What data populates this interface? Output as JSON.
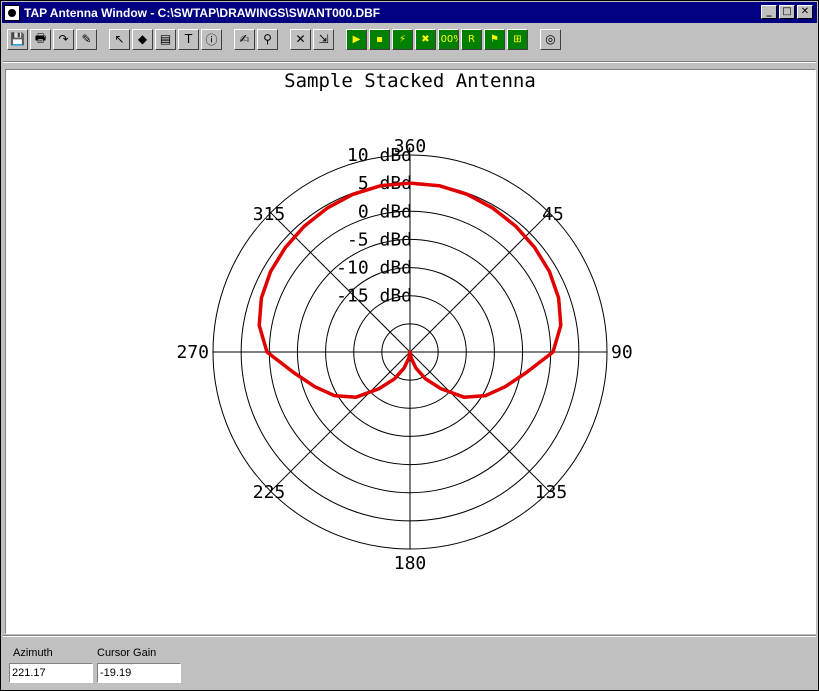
{
  "window": {
    "title": "TAP Antenna Window - C:\\SWTAP\\DRAWINGS\\SWANT000.DBF",
    "min_glyph": "_",
    "max_glyph": "□",
    "close_glyph": "✕"
  },
  "toolbar": {
    "buttons": [
      {
        "name": "save-icon",
        "glyph": "💾"
      },
      {
        "name": "print-icon",
        "glyph": "🖶"
      },
      {
        "name": "redo-icon",
        "glyph": "↷"
      },
      {
        "name": "edit-icon",
        "glyph": "✎"
      },
      {
        "name": "pointer-icon",
        "glyph": "↖"
      },
      {
        "name": "fill-icon",
        "glyph": "◆"
      },
      {
        "name": "document-icon",
        "glyph": "▤"
      },
      {
        "name": "text-icon",
        "glyph": "T"
      },
      {
        "name": "info-icon",
        "glyph": "ⓘ"
      },
      {
        "name": "sign-icon",
        "glyph": "✍"
      },
      {
        "name": "search-icon",
        "glyph": "⚲"
      },
      {
        "name": "delete-icon",
        "glyph": "✕"
      },
      {
        "name": "import-icon",
        "glyph": "⇲"
      },
      {
        "name": "play-icon",
        "glyph": "▶"
      },
      {
        "name": "dot-icon",
        "glyph": "▪"
      },
      {
        "name": "wand-icon",
        "glyph": "⚡"
      },
      {
        "name": "mark-icon",
        "glyph": "✖"
      },
      {
        "name": "zoom-100-icon",
        "glyph": "100%"
      },
      {
        "name": "r-icon",
        "glyph": "R"
      },
      {
        "name": "flag-icon",
        "glyph": "⚑"
      },
      {
        "name": "grid-icon",
        "glyph": "⊞"
      },
      {
        "name": "target-icon",
        "glyph": "◎"
      }
    ]
  },
  "chart_data": {
    "type": "polar",
    "title": "Sample Stacked Antenna",
    "radial_labels": [
      "10 dBd",
      "5 dBd",
      "0 dBd",
      "-5 dBd",
      "-10 dBd",
      "-15 dBd"
    ],
    "radial_levels": [
      10,
      5,
      0,
      -5,
      -10,
      -15,
      -20
    ],
    "angle_labels": [
      "360",
      "45",
      "90",
      "135",
      "180",
      "225",
      "270",
      "315"
    ],
    "angles_deg": [
      0,
      45,
      90,
      135,
      180,
      225,
      270,
      315
    ],
    "series_color": "#e00000",
    "pattern": {
      "azimuth_deg": [
        0,
        10,
        20,
        30,
        40,
        50,
        60,
        70,
        80,
        90,
        100,
        110,
        120,
        130,
        140,
        150,
        160,
        170,
        180,
        190,
        200,
        210,
        220,
        230,
        240,
        250,
        260,
        270,
        280,
        290,
        300,
        310,
        320,
        330,
        340,
        350
      ],
      "gain_dbd": [
        5.0,
        5.0,
        4.8,
        4.5,
        4.2,
        3.9,
        3.6,
        3.1,
        2.2,
        0.4,
        -4.0,
        -7.0,
        -9.5,
        -12.5,
        -16.5,
        -19.5,
        -22,
        -24,
        -25,
        -24,
        -22,
        -19.5,
        -16.5,
        -12.5,
        -9.5,
        -7.0,
        -4.0,
        0.4,
        2.2,
        3.1,
        3.6,
        3.9,
        4.2,
        4.5,
        4.8,
        5.0
      ]
    }
  },
  "status": {
    "azimuth_label": "Azimuth",
    "azimuth_value": "221.17",
    "gain_label": "Cursor Gain",
    "gain_value": "-19.19"
  }
}
